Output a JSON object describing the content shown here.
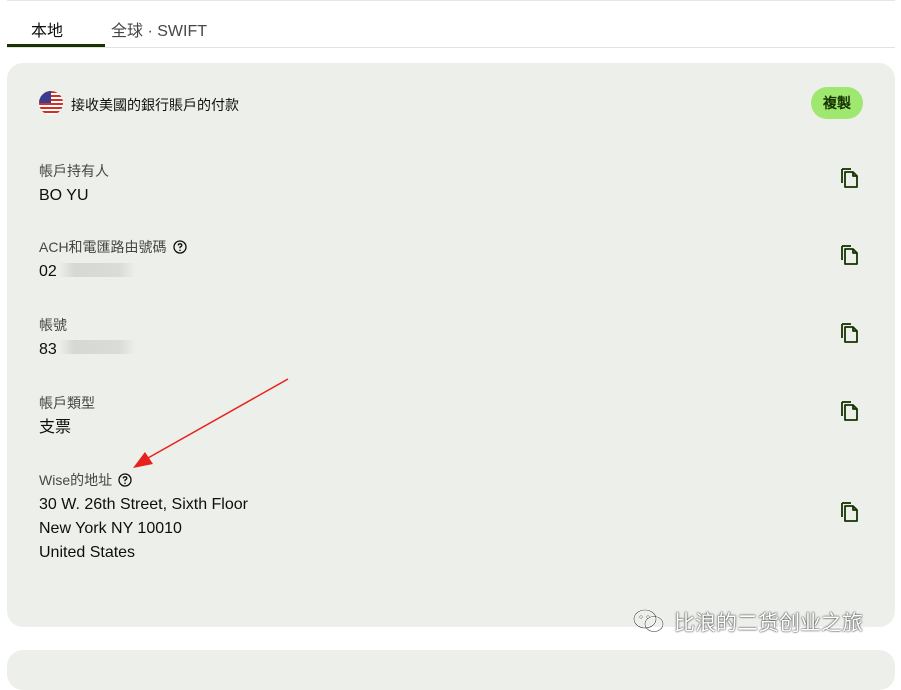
{
  "tabs": [
    {
      "label": "本地",
      "active": true
    },
    {
      "label": "全球 · SWIFT",
      "active": false
    }
  ],
  "card": {
    "title": "接收美國的銀行賬戶的付款",
    "copy_all_label": "複製",
    "fields": [
      {
        "label": "帳戶持有人",
        "value": "BO YU"
      },
      {
        "label": "ACH和電匯路由號碼",
        "value": "02",
        "has_help": true
      },
      {
        "label": "帳號",
        "value": "83"
      },
      {
        "label": "帳戶類型",
        "value": "支票"
      },
      {
        "label": "Wise的地址",
        "has_help": true,
        "lines": [
          "30 W. 26th Street, Sixth Floor",
          "New York NY 10010",
          "United States"
        ]
      }
    ]
  },
  "watermark": {
    "text": "比浪的二货创业之旅",
    "icon": "wechat-icon"
  },
  "colors": {
    "accent": "#9fe870",
    "dark_green": "#163300",
    "card_bg": "#ecefea",
    "arrow": "#e8211c"
  }
}
